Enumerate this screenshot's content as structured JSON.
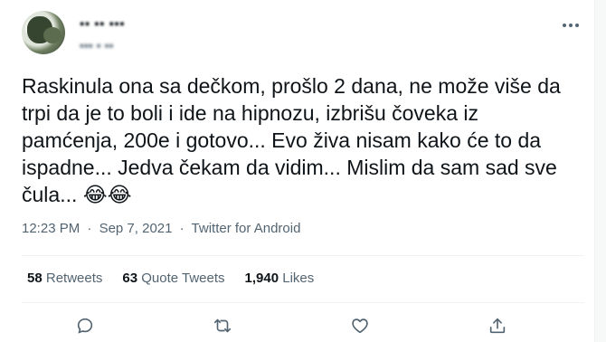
{
  "author": {
    "name": "▪▪ ▪▪ ▪▪▪",
    "handle": "▪▪▪ ▪ ▪▪"
  },
  "tweet": {
    "text": "Raskinula ona sa dečkom, prošlo 2 dana, ne može više da trpi da je to boli i ide na hipnozu, izbrišu čoveka iz pamćenja, 200e i gotovo... Evo živa nisam kako će to da ispadne... Jedva čekam da vidim... Mislim da sam sad sve čula...",
    "emoji": "😂😂"
  },
  "meta": {
    "time": "12:23 PM",
    "separator": "·",
    "date": "Sep 7, 2021",
    "source": "Twitter for Android"
  },
  "stats": {
    "retweets_count": "58",
    "retweets_label": "Retweets",
    "quotes_count": "63",
    "quotes_label": "Quote Tweets",
    "likes_count": "1,940",
    "likes_label": "Likes"
  },
  "icons": {
    "more": "more-icon",
    "reply": "reply-icon",
    "retweet": "retweet-icon",
    "like": "like-icon",
    "share": "share-icon"
  },
  "colors": {
    "text": "#0f1419",
    "secondary": "#536471",
    "divider": "#eff3f4"
  }
}
